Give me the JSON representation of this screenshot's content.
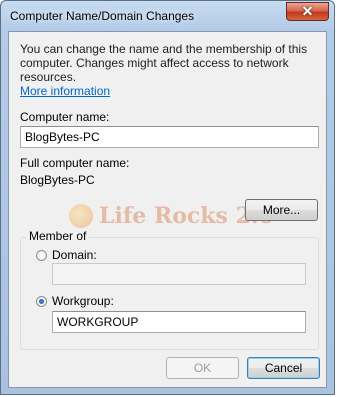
{
  "window": {
    "title": "Computer Name/Domain Changes"
  },
  "description": {
    "text": "You can change the name and the membership of this computer. Changes might affect access to network resources.",
    "link": "More information"
  },
  "computer_name": {
    "label": "Computer name:",
    "value": "BlogBytes-PC"
  },
  "full_name": {
    "label": "Full computer name:",
    "value": "BlogBytes-PC"
  },
  "more_button": "More...",
  "watermark": "Life Rocks 2.0",
  "member_of": {
    "legend": "Member of",
    "domain": {
      "label": "Domain:",
      "selected": false,
      "value": ""
    },
    "workgroup": {
      "label": "Workgroup:",
      "selected": true,
      "value": "WORKGROUP"
    }
  },
  "buttons": {
    "ok": "OK",
    "cancel": "Cancel"
  },
  "icons": {
    "close": "close-icon",
    "watermark_logo": "globe-logo-icon"
  }
}
